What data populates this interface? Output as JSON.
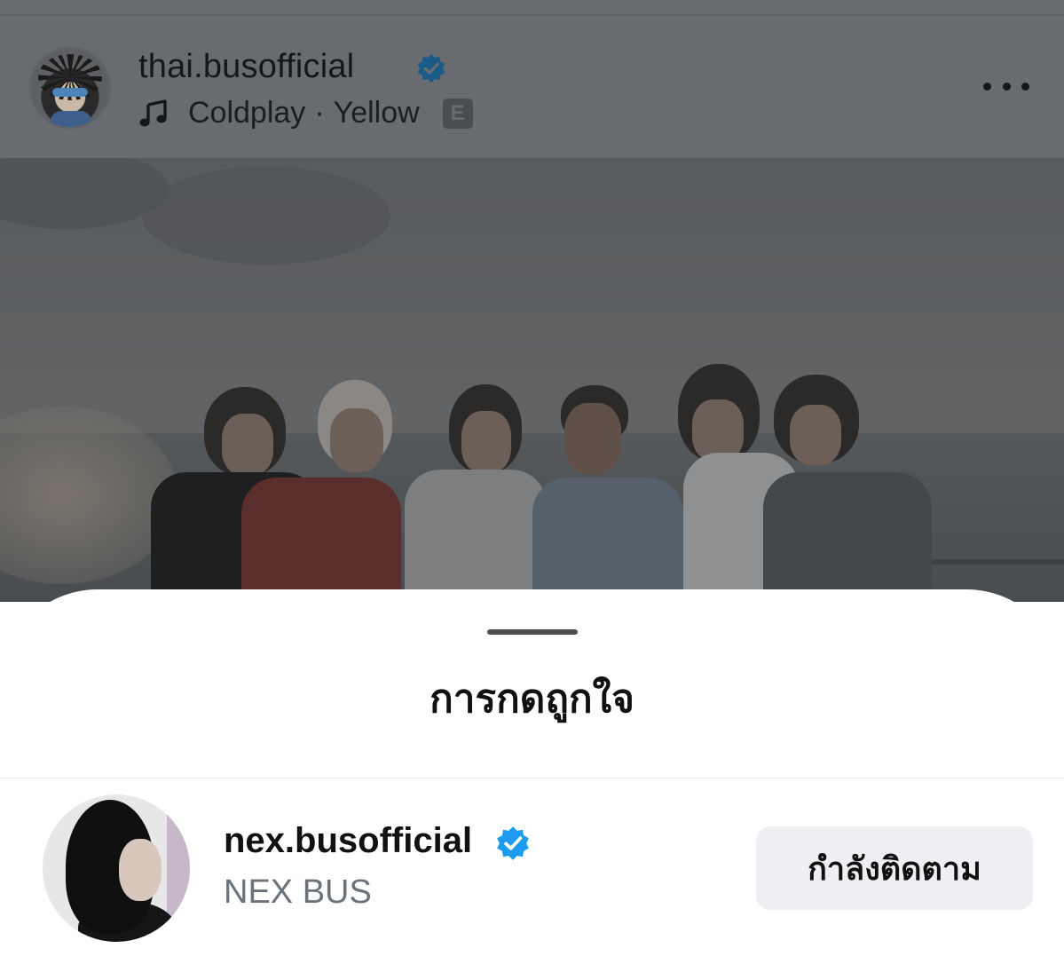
{
  "post": {
    "username": "thai.busofficial",
    "verified": true,
    "music": {
      "artist": "Coldplay",
      "separator": "·",
      "song": "Yellow",
      "explicit_badge": "E"
    },
    "more_icon": "more-horizontal-icon"
  },
  "likes_sheet": {
    "title": "การกดถูกใจ",
    "users": [
      {
        "username": "nex.busofficial",
        "verified": true,
        "full_name": "NEX BUS",
        "action_label": "กำลังติดตาม"
      }
    ]
  },
  "colors": {
    "verified_blue": "#1d9bf0",
    "dim_overlay": "#686c70",
    "sheet_background": "#ffffff",
    "button_background": "#efeff3"
  }
}
